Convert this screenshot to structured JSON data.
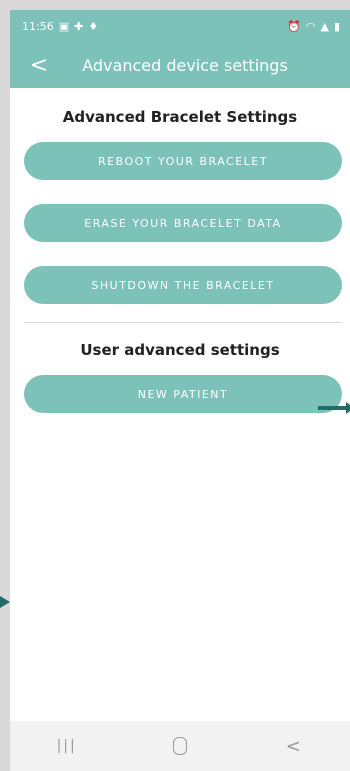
{
  "status_bar": {
    "time": "11:56",
    "left_icons": [
      "image-icon",
      "plus-icon",
      "notification-icon"
    ],
    "right_icons": [
      "alarm-icon",
      "wifi-icon",
      "signal-icon",
      "battery-icon"
    ]
  },
  "header": {
    "back_icon": "<",
    "title": "Advanced device settings"
  },
  "bracelet_section": {
    "title": "Advanced Bracelet Settings",
    "buttons": [
      "REBOOT YOUR BRACELET",
      "ERASE YOUR BRACELET DATA",
      "SHUTDOWN THE BRACELET"
    ]
  },
  "user_section": {
    "title": "User advanced settings",
    "buttons": [
      "NEW PATIENT"
    ]
  },
  "nav": {
    "recent": "|||",
    "back": "<"
  },
  "colors": {
    "accent": "#7cc2b8",
    "annotation_arrow": "#1f6d66"
  }
}
